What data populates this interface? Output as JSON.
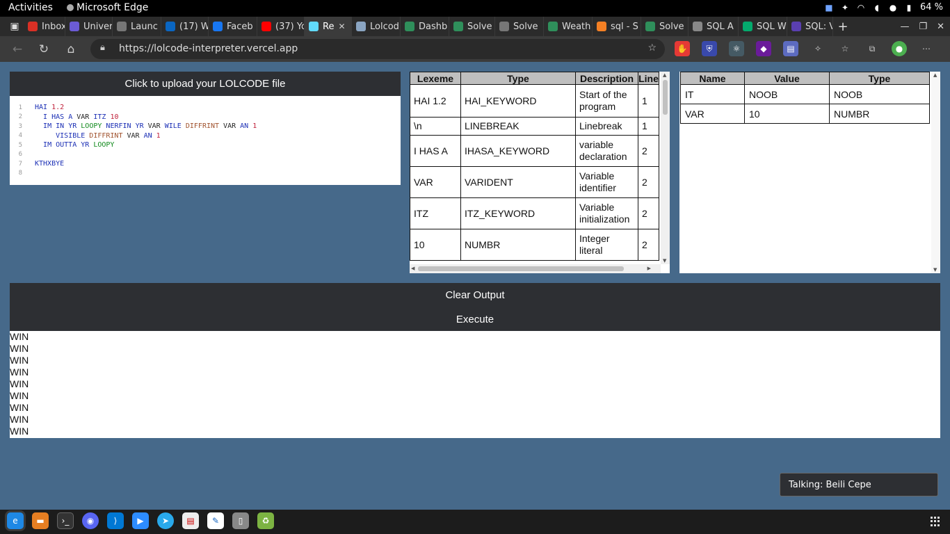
{
  "os": {
    "activities": "Activities",
    "app_name": "Microsoft Edge",
    "battery": "64 %"
  },
  "browser": {
    "tabs": [
      {
        "label": "Inbox",
        "icon": "gmail-icon",
        "color": "#d93025"
      },
      {
        "label": "Univer",
        "icon": "university-icon",
        "color": "#6b5bd6"
      },
      {
        "label": "Launc",
        "icon": "page-icon",
        "color": "#777777"
      },
      {
        "label": "(17) W",
        "icon": "linkedin-icon",
        "color": "#0a66c2"
      },
      {
        "label": "Faceb",
        "icon": "facebook-icon",
        "color": "#1877f2"
      },
      {
        "label": "(37) Yo",
        "icon": "youtube-icon",
        "color": "#ff0000"
      },
      {
        "label": "Re",
        "icon": "react-icon",
        "color": "#61dafb",
        "active": true
      },
      {
        "label": "Lolcod",
        "icon": "lolcode-icon",
        "color": "#8aa5c2"
      },
      {
        "label": "Dashb",
        "icon": "dashboard-icon",
        "color": "#2f8f5b"
      },
      {
        "label": "Solve",
        "icon": "solve-icon",
        "color": "#2f8f5b"
      },
      {
        "label": "Solve",
        "icon": "page-icon",
        "color": "#777777"
      },
      {
        "label": "Weath",
        "icon": "weather-icon",
        "color": "#2f8f5b"
      },
      {
        "label": "sql - S",
        "icon": "stackoverflow-icon",
        "color": "#f48024"
      },
      {
        "label": "Solve",
        "icon": "solve-icon",
        "color": "#2f8f5b"
      },
      {
        "label": "SQL A",
        "icon": "sql-icon",
        "color": "#888888"
      },
      {
        "label": "SQL W",
        "icon": "w3schools-icon",
        "color": "#04aa6d"
      },
      {
        "label": "SQL: V",
        "icon": "sql-icon",
        "color": "#5a3fb0"
      }
    ],
    "url": "https://lolcode-interpreter.vercel.app"
  },
  "app": {
    "upload_label": "Click to upload your LOLCODE file",
    "code_lines": [
      "HAI 1.2",
      "  I HAS A VAR ITZ 10",
      "  IM IN YR LOOPY NERFIN YR VAR WILE DIFFRINT VAR AN 1",
      "     VISIBLE DIFFRINT VAR AN 1",
      "  IM OUTTA YR LOOPY",
      "",
      "KTHXBYE",
      ""
    ],
    "lexeme_headers": [
      "Lexeme",
      "Type",
      "Description",
      "Line"
    ],
    "lexemes": [
      [
        "HAI 1.2",
        "HAI_KEYWORD",
        "Start of the program",
        "1"
      ],
      [
        "\\n",
        "LINEBREAK",
        "Linebreak",
        "1"
      ],
      [
        "I HAS A",
        "IHASA_KEYWORD",
        "variable declaration",
        "2"
      ],
      [
        "VAR",
        "VARIDENT",
        "Variable identifier",
        "2"
      ],
      [
        "ITZ",
        "ITZ_KEYWORD",
        "Variable initialization",
        "2"
      ],
      [
        "10",
        "NUMBR",
        "Integer literal",
        "2"
      ]
    ],
    "symbol_headers": [
      "Name",
      "Value",
      "Type"
    ],
    "symbols": [
      [
        "IT",
        "NOOB",
        "NOOB"
      ],
      [
        "VAR",
        "10",
        "NUMBR"
      ]
    ],
    "clear_label": "Clear Output",
    "execute_label": "Execute",
    "output_lines": [
      "WIN",
      "WIN",
      "WIN",
      "WIN",
      "WIN",
      "WIN",
      "WIN",
      "WIN",
      "WIN"
    ]
  },
  "notification": "Talking: Beili Cepe"
}
